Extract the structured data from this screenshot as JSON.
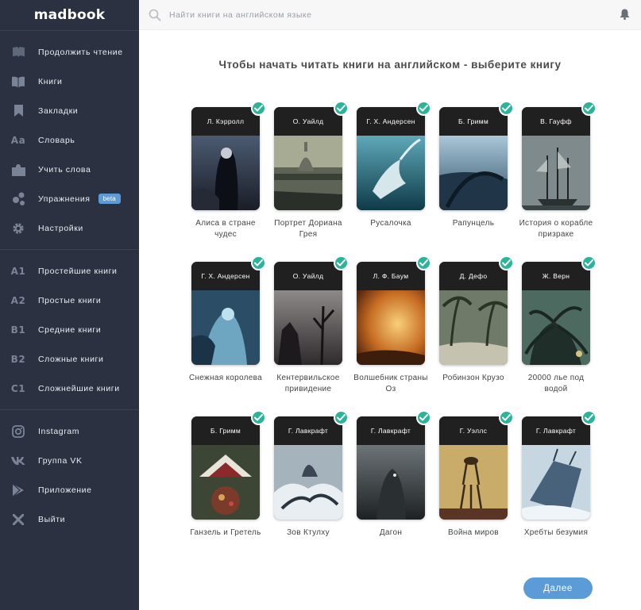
{
  "brand": "madbook",
  "search": {
    "placeholder": "Найти книги на английском языке"
  },
  "sidebar": {
    "main": [
      {
        "label": "Продолжить чтение",
        "icon": "book-open-icon"
      },
      {
        "label": "Книги",
        "icon": "books-icon"
      },
      {
        "label": "Закладки",
        "icon": "bookmark-icon"
      },
      {
        "label": "Словарь",
        "icon": "dictionary-icon"
      },
      {
        "label": "Учить слова",
        "icon": "puzzle-icon"
      },
      {
        "label": "Упражнения",
        "icon": "exercises-icon",
        "badge": "beta"
      },
      {
        "label": "Настройки",
        "icon": "gear-icon"
      }
    ],
    "levels": [
      {
        "code": "A1",
        "label": "Простейшие книги"
      },
      {
        "code": "A2",
        "label": "Простые книги"
      },
      {
        "code": "B1",
        "label": "Средние книги"
      },
      {
        "code": "B2",
        "label": "Сложные книги"
      },
      {
        "code": "C1",
        "label": "Сложнейшие книги"
      }
    ],
    "extra": [
      {
        "label": "Instagram",
        "icon": "instagram-icon"
      },
      {
        "label": "Группа VK",
        "icon": "vk-icon"
      },
      {
        "label": "Приложение",
        "icon": "play-store-icon"
      },
      {
        "label": "Выйти",
        "icon": "close-icon"
      }
    ]
  },
  "main": {
    "title": "Чтобы начать читать книги на английском - выберите книгу",
    "next_label": "Далее",
    "check_color": "#2db39a",
    "accent_color": "#5b9bd8",
    "books": [
      {
        "author": "Л. Кэрролл",
        "title": "Алиса в стране чудес"
      },
      {
        "author": "О. Уайлд",
        "title": "Портрет Дориана Грея"
      },
      {
        "author": "Г. Х. Андерсен",
        "title": "Русалочка"
      },
      {
        "author": "Б. Гримм",
        "title": "Рапунцель"
      },
      {
        "author": "В. Гауфф",
        "title": "История о корабле призраке"
      },
      {
        "author": "Г. Х. Андерсен",
        "title": "Снежная королева"
      },
      {
        "author": "О. Уайлд",
        "title": "Кентервильское привидение"
      },
      {
        "author": "Л. Ф. Баум",
        "title": "Волшебник страны Оз"
      },
      {
        "author": "Д. Дефо",
        "title": "Робинзон Крузо"
      },
      {
        "author": "Ж. Верн",
        "title": "20000 лье под водой"
      },
      {
        "author": "Б. Гримм",
        "title": "Ганзель и Гретель"
      },
      {
        "author": "Г. Лавкрафт",
        "title": "Зов Ктулху"
      },
      {
        "author": "Г. Лавкрафт",
        "title": "Дагон"
      },
      {
        "author": "Г. Уэллс",
        "title": "Война миров"
      },
      {
        "author": "Г. Лавкрафт",
        "title": "Хребты безумия"
      }
    ]
  }
}
